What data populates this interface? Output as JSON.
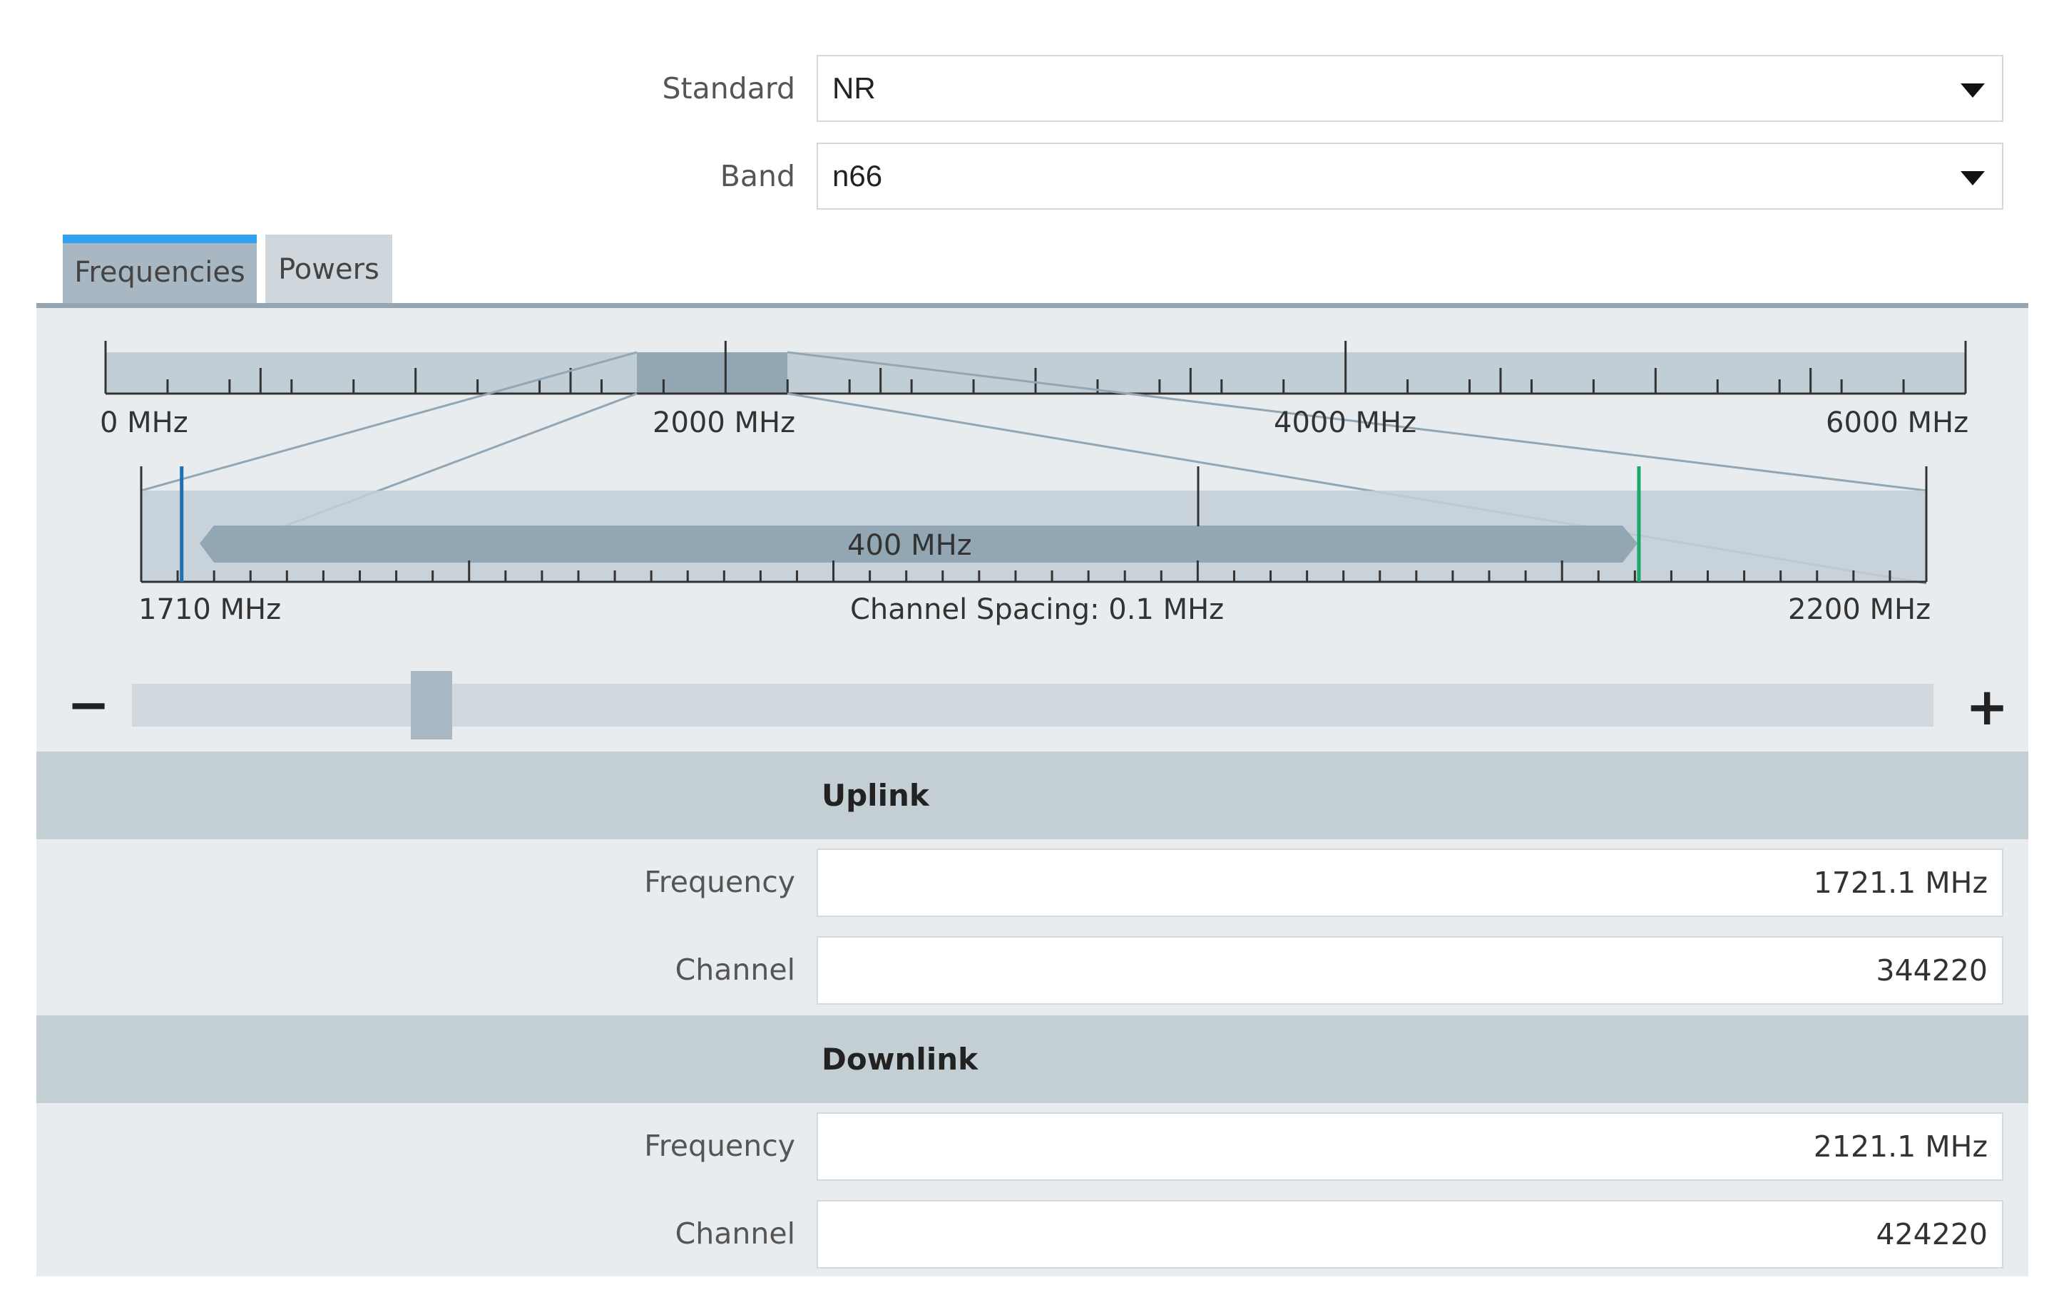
{
  "standard": {
    "label": "Standard",
    "value": "NR"
  },
  "band": {
    "label": "Band",
    "value": "n66"
  },
  "tabs": [
    {
      "label": "Frequencies",
      "active": true
    },
    {
      "label": "Powers",
      "active": false
    }
  ],
  "overview_axis": {
    "labels": [
      "0 MHz",
      "2000 MHz",
      "4000 MHz",
      "6000 MHz"
    ],
    "range_mhz": [
      0,
      6000
    ],
    "selection_mhz": [
      1710,
      2200
    ]
  },
  "band_axis": {
    "start_label": "1710 MHz",
    "end_label": "2200 MHz",
    "spacing_label": "Channel Spacing: 0.1 MHz",
    "span_label": "400 MHz",
    "range_mhz": [
      1710,
      2200
    ],
    "uplink_marker_mhz": 1721.1,
    "downlink_marker_mhz": 2121.1
  },
  "slider": {
    "minus": "−",
    "plus": "+",
    "position": 0.17
  },
  "uplink": {
    "title": "Uplink",
    "frequency_label": "Frequency",
    "frequency_value": "1721.1 MHz",
    "channel_label": "Channel",
    "channel_value": "344220"
  },
  "downlink": {
    "title": "Downlink",
    "frequency_label": "Frequency",
    "frequency_value": "2121.1 MHz",
    "channel_label": "Channel",
    "channel_value": "424220"
  },
  "colors": {
    "tab_accent": "#2ea2f0",
    "uplink_marker": "#1f6fb5",
    "downlink_marker": "#1aa86a"
  }
}
